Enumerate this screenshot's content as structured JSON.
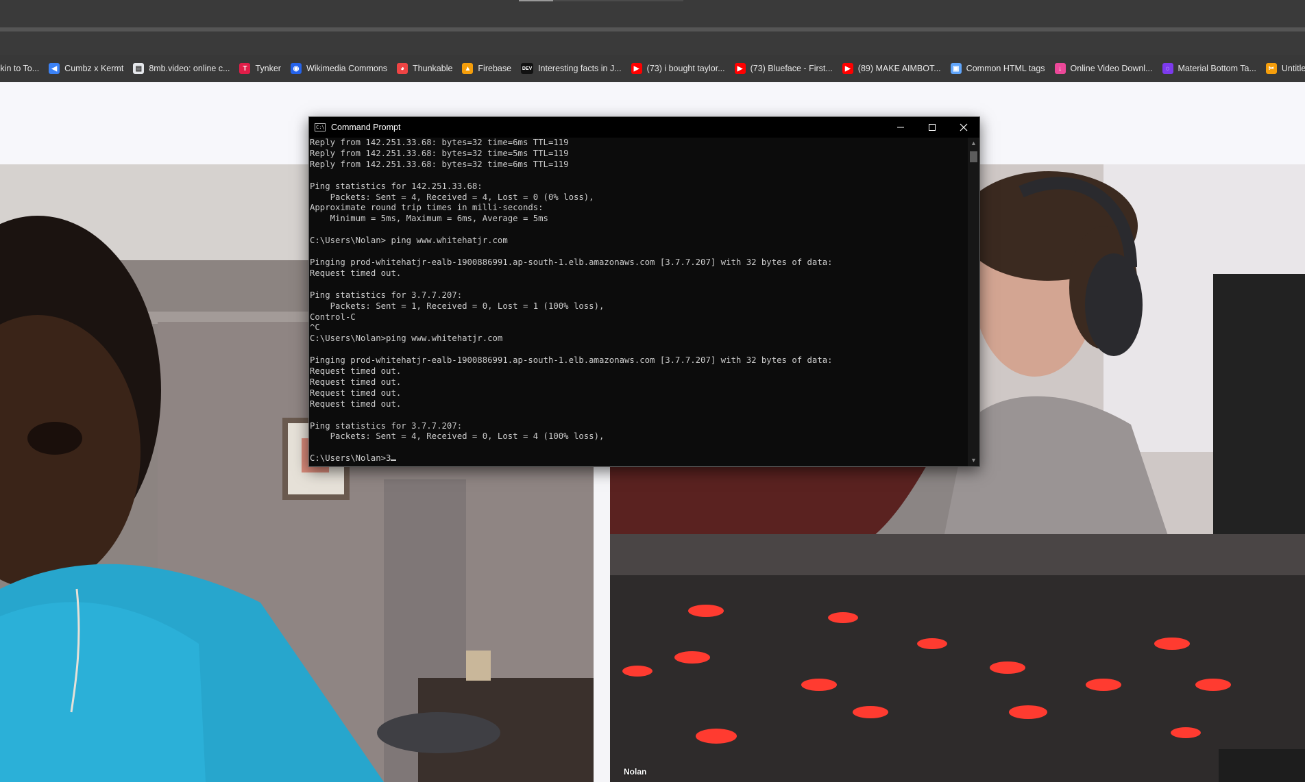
{
  "bookmarks": [
    {
      "icon": "page-icon",
      "label": "...kin to To...",
      "color": "#3a3a3a"
    },
    {
      "icon": "arrow-icon",
      "label": "Cumbz x Kermt",
      "color": "#3b82f6"
    },
    {
      "icon": "doc-icon",
      "label": "8mb.video: online c...",
      "color": "#e5e7eb"
    },
    {
      "icon": "tynker-icon",
      "label": "Tynker",
      "color": "#e11d48"
    },
    {
      "icon": "wikimedia-icon",
      "label": "Wikimedia Commons",
      "color": "#2563eb"
    },
    {
      "icon": "thunkable-icon",
      "label": "Thunkable",
      "color": "#ef4444"
    },
    {
      "icon": "firebase-icon",
      "label": "Firebase",
      "color": "#f59e0b"
    },
    {
      "icon": "dev-icon",
      "label": "Interesting facts in J...",
      "color": "#111111"
    },
    {
      "icon": "youtube-icon",
      "label": "(73) i bought taylor...",
      "color": "#ff0000"
    },
    {
      "icon": "youtube-icon",
      "label": "(73) Blueface - First...",
      "color": "#ff0000"
    },
    {
      "icon": "youtube-icon",
      "label": "(89) MAKE AIMBOT...",
      "color": "#ff0000"
    },
    {
      "icon": "save-icon",
      "label": "Common HTML tags",
      "color": "#60a5fa"
    },
    {
      "icon": "video-download-icon",
      "label": "Online Video Downl...",
      "color": "#ec4899"
    },
    {
      "icon": "material-icon",
      "label": "Material Bottom Ta...",
      "color": "#7c3aed"
    },
    {
      "icon": "clipped-icon",
      "label": "Untitled - Clipped",
      "color": "#f59e0b"
    }
  ],
  "cmd": {
    "title": "Command Prompt",
    "lines": [
      "Reply from 142.251.33.68: bytes=32 time=6ms TTL=119",
      "Reply from 142.251.33.68: bytes=32 time=5ms TTL=119",
      "Reply from 142.251.33.68: bytes=32 time=6ms TTL=119",
      "",
      "Ping statistics for 142.251.33.68:",
      "    Packets: Sent = 4, Received = 4, Lost = 0 (0% loss),",
      "Approximate round trip times in milli-seconds:",
      "    Minimum = 5ms, Maximum = 6ms, Average = 5ms",
      "",
      "C:\\Users\\Nolan> ping www.whitehatjr.com",
      "",
      "Pinging prod-whitehatjr-ealb-1900886991.ap-south-1.elb.amazonaws.com [3.7.7.207] with 32 bytes of data:",
      "Request timed out.",
      "",
      "Ping statistics for 3.7.7.207:",
      "    Packets: Sent = 1, Received = 0, Lost = 1 (100% loss),",
      "Control-C",
      "^C",
      "C:\\Users\\Nolan>ping www.whitehatjr.com",
      "",
      "Pinging prod-whitehatjr-ealb-1900886991.ap-south-1.elb.amazonaws.com [3.7.7.207] with 32 bytes of data:",
      "Request timed out.",
      "Request timed out.",
      "Request timed out.",
      "Request timed out.",
      "",
      "Ping statistics for 3.7.7.207:",
      "    Packets: Sent = 4, Received = 0, Lost = 4 (100% loss),",
      ""
    ],
    "prompt": "C:\\Users\\Nolan>3"
  },
  "video": {
    "right_name": "Nolan"
  },
  "colors": {
    "chrome_dark": "#3a3a3a",
    "console_bg": "#0c0c0c",
    "console_text": "#cccccc",
    "page_bg": "#f7f7fb"
  }
}
